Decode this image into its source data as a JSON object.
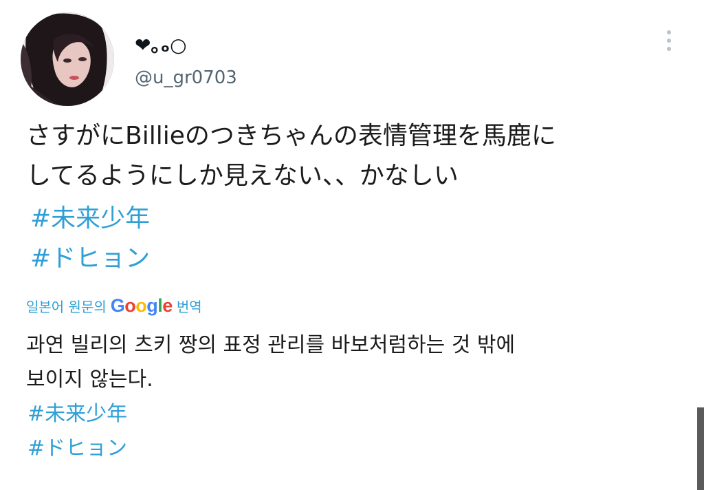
{
  "tweet": {
    "display_name": "❤︎｡ₒ○",
    "handle": "@u_gr0703",
    "text_lines": [
      "さすがにBillieのつきちゃんの表情管理を馬鹿に",
      "してるようにしか見えない、、かなしい"
    ],
    "hashtags": [
      "#未来少年",
      "#ドヒョン"
    ]
  },
  "translation": {
    "label_prefix": "일본어 원문의",
    "provider_parts": [
      "G",
      "o",
      "o",
      "g",
      "l",
      "e"
    ],
    "label_suffix": "번역",
    "text_lines": [
      "과연 빌리의 츠키 짱의 표정 관리를 바보처럼하는 것 밖에",
      "보이지 않는다."
    ],
    "hashtags": [
      "#未来少年",
      "#ドヒョン"
    ]
  },
  "icons": {
    "more": "more-vertical-icon",
    "avatar": "profile-photo"
  },
  "colors": {
    "link": "#2f9fd6",
    "secondary_text": "#536471",
    "google_blue": "#4285f4",
    "google_red": "#ea4335",
    "google_yellow": "#fbbc05",
    "google_green": "#34a853"
  }
}
